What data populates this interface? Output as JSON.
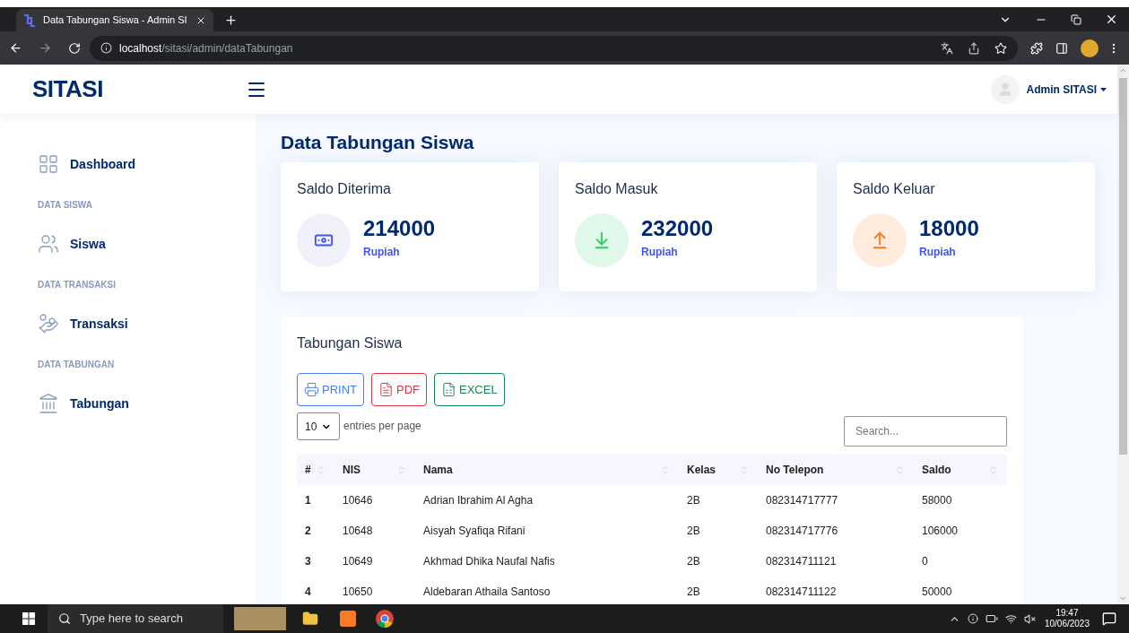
{
  "browser": {
    "tab_title": "Data Tabungan Siswa - Admin SI",
    "url_host": "localhost",
    "url_path": "/sitasi/admin/dataTabungan"
  },
  "header": {
    "logo": "SITASI",
    "user_name": "Admin SITASI"
  },
  "sidebar": {
    "items": [
      {
        "kind": "link",
        "label": "Dashboard"
      },
      {
        "kind": "heading",
        "label": "DATA SISWA"
      },
      {
        "kind": "link",
        "label": "Siswa"
      },
      {
        "kind": "heading",
        "label": "DATA TRANSAKSI"
      },
      {
        "kind": "link",
        "label": "Transaksi"
      },
      {
        "kind": "heading",
        "label": "DATA TABUNGAN"
      },
      {
        "kind": "link",
        "label": "Tabungan"
      }
    ]
  },
  "page_title": "Data Tabungan Siswa",
  "cards": [
    {
      "kind": "received",
      "title": "Saldo Diterima",
      "value": "214000",
      "unit": "Rupiah"
    },
    {
      "kind": "in",
      "title": "Saldo Masuk",
      "value": "232000",
      "unit": "Rupiah"
    },
    {
      "kind": "out",
      "title": "Saldo Keluar",
      "value": "18000",
      "unit": "Rupiah"
    }
  ],
  "table_card": {
    "title": "Tabungan Siswa",
    "export_buttons": [
      {
        "kind": "print",
        "label": "PRINT"
      },
      {
        "kind": "pdf",
        "label": "PDF"
      },
      {
        "kind": "excel",
        "label": "EXCEL"
      }
    ],
    "entries_value": "10",
    "entries_label": "entries per page",
    "search_placeholder": "Search...",
    "columns": [
      "#",
      "NIS",
      "Nama",
      "Kelas",
      "No Telepon",
      "Saldo"
    ],
    "rows": [
      [
        "1",
        "10646",
        "Adrian Ibrahim Al Agha",
        "2B",
        "082314717777",
        "58000"
      ],
      [
        "2",
        "10648",
        "Aisyah Syafiqa Rifani",
        "2B",
        "082314717776",
        "106000"
      ],
      [
        "3",
        "10649",
        "Akhmad Dhika Naufal Nafis",
        "2B",
        "082314711121",
        "0"
      ],
      [
        "4",
        "10650",
        "Aldebaran Athaila Santoso",
        "2B",
        "082314711122",
        "50000"
      ]
    ]
  },
  "taskbar": {
    "search_placeholder": "Type here to search",
    "time": "19:47",
    "date": "10/06/2023"
  }
}
